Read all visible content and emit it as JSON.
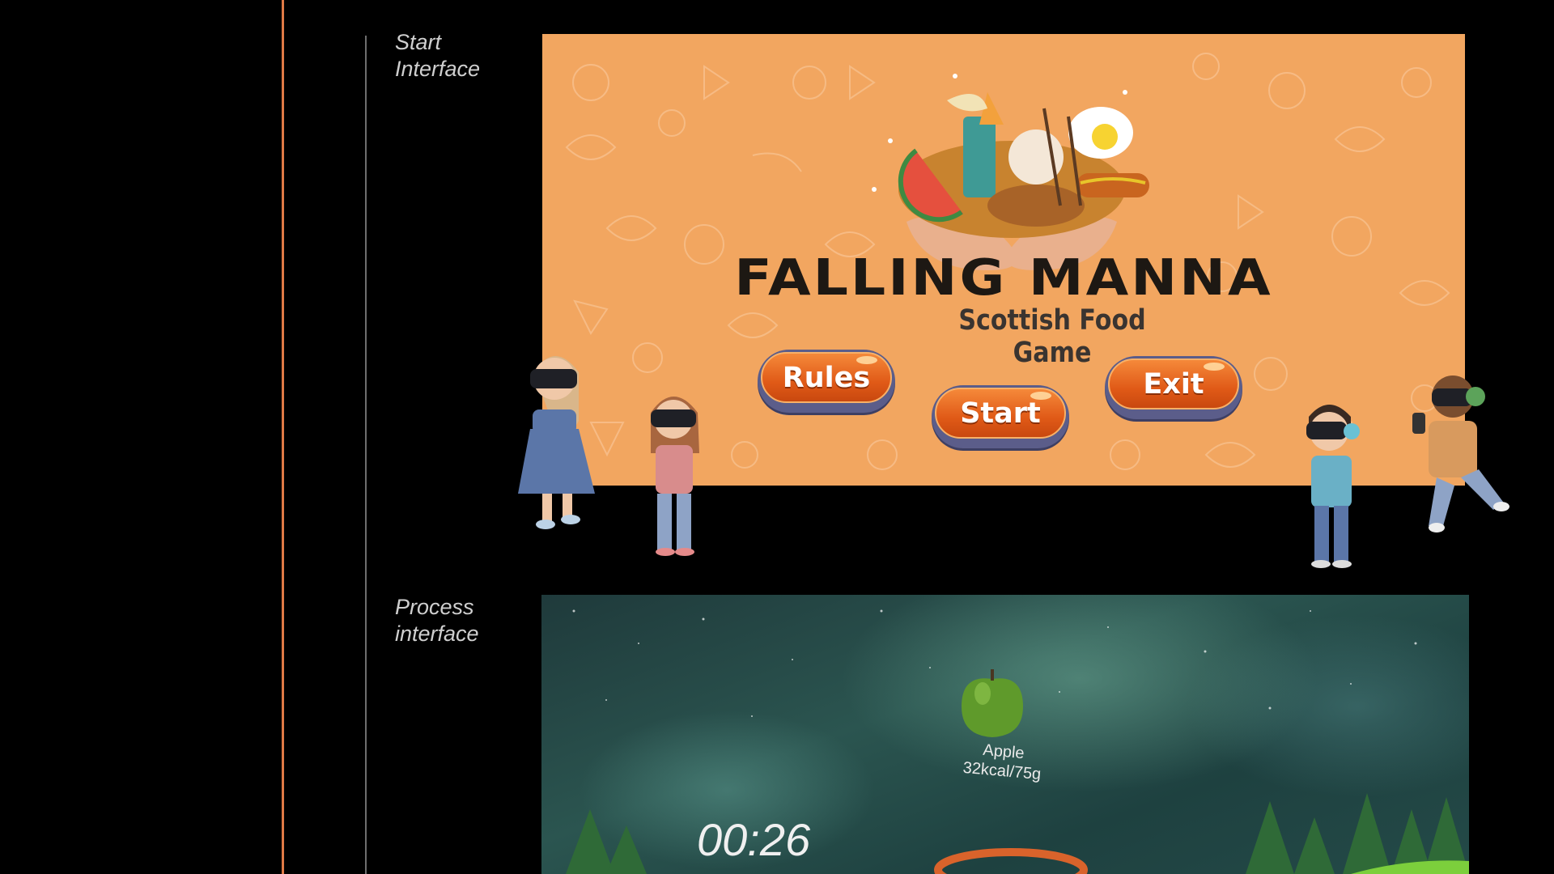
{
  "labels": {
    "start_interface": [
      "Start",
      "Interface"
    ],
    "process_interface": [
      "Process",
      "interface"
    ]
  },
  "start_screen": {
    "title": "FALLING MANNA",
    "subtitle": "Scottish Food Game",
    "buttons": {
      "rules": "Rules",
      "start": "Start",
      "exit": "Exit"
    }
  },
  "process_screen": {
    "food_name": "Apple",
    "food_calories": "32kcal/75g",
    "timer": "00:26"
  },
  "colors": {
    "accent_line": "#e07a45",
    "start_background": "#f2a660",
    "button_orange": "#e86a22",
    "title_dark": "#1d1813"
  }
}
